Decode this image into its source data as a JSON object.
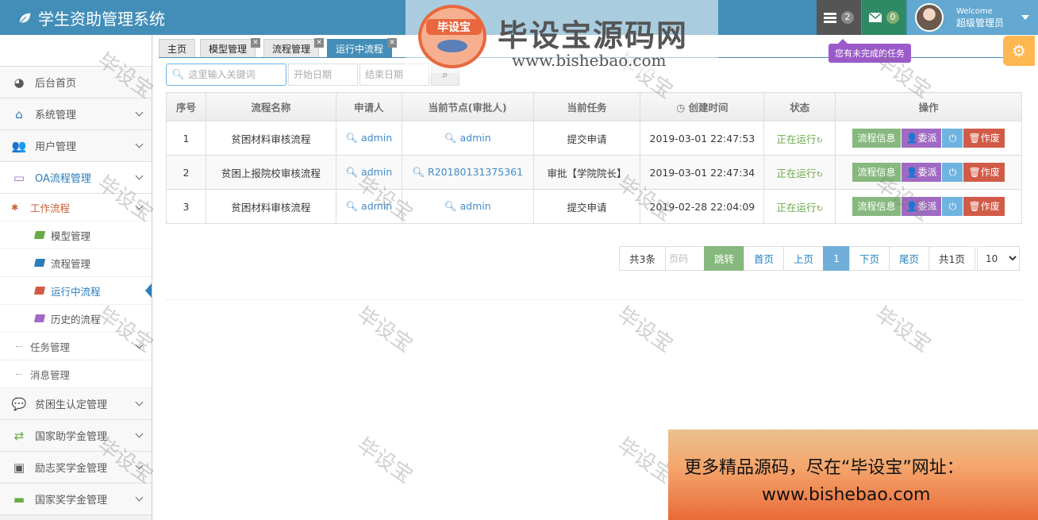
{
  "app": {
    "title": "学生资助管理系统"
  },
  "navbar": {
    "tasks_count": "2",
    "msgs_count": "0",
    "user_welcome": "Welcome",
    "user_name": "超级管理员",
    "tooltip": "您有未完成的任务"
  },
  "sidebar": {
    "items": [
      {
        "label": "后台首页",
        "icon": "dashboard-icon"
      },
      {
        "label": "系统管理",
        "icon": "home-icon"
      },
      {
        "label": "用户管理",
        "icon": "users-icon"
      },
      {
        "label": "OA流程管理",
        "icon": "desktop-icon"
      },
      {
        "label": "贫困生认定管理",
        "icon": "comments-icon"
      },
      {
        "label": "国家助学金管理",
        "icon": "exchange-icon"
      },
      {
        "label": "励志奖学金管理",
        "icon": "monitor-icon"
      },
      {
        "label": "国家奖学金管理",
        "icon": "credit-card-icon"
      }
    ],
    "oa_sub": {
      "workflow": "工作流程",
      "model": "模型管理",
      "process": "流程管理",
      "running": "运行中流程",
      "history": "历史的流程",
      "tasks": "任务管理",
      "messages": "消息管理"
    }
  },
  "tabs": [
    {
      "label": "主页"
    },
    {
      "label": "模型管理"
    },
    {
      "label": "流程管理"
    },
    {
      "label": "运行中流程"
    }
  ],
  "search": {
    "keyword_placeholder": "这里输入关键词",
    "start_placeholder": "开始日期",
    "end_placeholder": "结束日期"
  },
  "table": {
    "headers": [
      "序号",
      "流程名称",
      "申请人",
      "当前节点(审批人)",
      "当前任务",
      "创建时间",
      "状态",
      "操作"
    ],
    "rows": [
      {
        "no": "1",
        "name": "贫困材料审核流程",
        "applicant": "admin",
        "node": "admin",
        "task": "提交申请",
        "time": "2019-03-01 22:47:53",
        "status": "正在运行"
      },
      {
        "no": "2",
        "name": "贫困上报院校审核流程",
        "applicant": "admin",
        "node": "R20180131375361",
        "task": "审批【学院院长】",
        "time": "2019-03-01 22:47:34",
        "status": "正在运行"
      },
      {
        "no": "3",
        "name": "贫困材料审核流程",
        "applicant": "admin",
        "node": "admin",
        "task": "提交申请",
        "time": "2019-02-28 22:04:09",
        "status": "正在运行"
      }
    ],
    "btn_info": "流程信息",
    "btn_assign": "委派",
    "btn_void": "作废"
  },
  "pager": {
    "total": "共3条",
    "page_placeholder": "页码",
    "go": "跳转",
    "first": "首页",
    "prev": "上页",
    "current": "1",
    "next": "下页",
    "last": "尾页",
    "pages": "共1页",
    "size": "10"
  },
  "overlay": {
    "watermark": "毕设宝",
    "logo_badge": "毕设宝",
    "logo_title": "毕设宝源码网",
    "logo_url": "www.bishebao.com",
    "promo_line1": "更多精品源码，尽在“毕设宝”网址：",
    "promo_line2": "www.bishebao.com"
  },
  "colors": {
    "navbar": "#438eb9",
    "accent": "#2b7dbc",
    "success": "#87b87f",
    "danger": "#d15b47",
    "purple": "#a069c3"
  }
}
